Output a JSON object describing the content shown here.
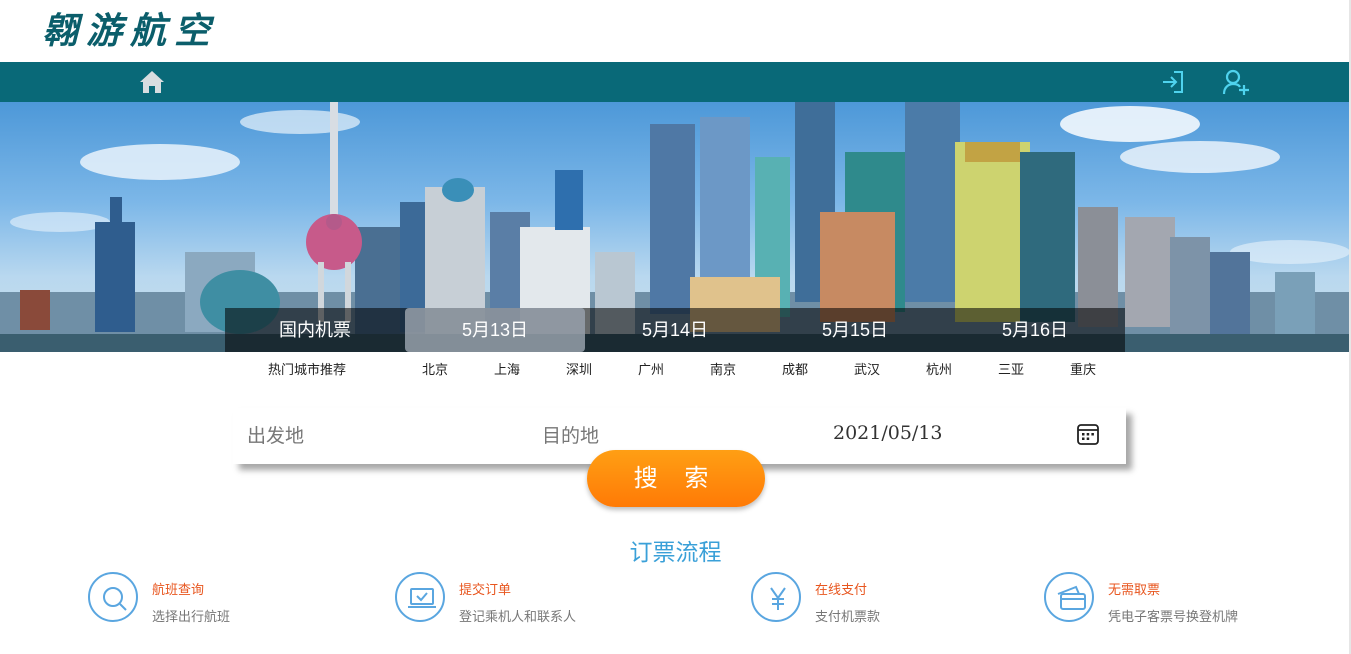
{
  "header": {
    "logo_text": "翱游航空"
  },
  "nav": {
    "home_icon": "home-icon",
    "login_icon": "login-icon",
    "register_icon": "add-user-icon",
    "bar_color": "#096978"
  },
  "banner": {
    "image": "shanghai-skyline-photo"
  },
  "date_tabs": [
    {
      "label": "国内机票"
    },
    {
      "label": "5月13日",
      "active": true
    },
    {
      "label": "5月14日"
    },
    {
      "label": "5月15日"
    },
    {
      "label": "5月16日"
    }
  ],
  "hot_cities": {
    "label": "热门城市推荐",
    "cities": [
      "北京",
      "上海",
      "深圳",
      "广州",
      "南京",
      "成都",
      "武汉",
      "杭州",
      "三亚",
      "重庆"
    ]
  },
  "search": {
    "from_placeholder": "出发地",
    "to_placeholder": "目的地",
    "date_value": "2021/05/13",
    "calendar_icon": "calendar-icon",
    "button_label": "搜 索",
    "button_color": "#ff8a0d"
  },
  "process": {
    "title": "订票流程",
    "steps": [
      {
        "title": "航班查询",
        "desc": "选择出行航班",
        "icon": "search-icon"
      },
      {
        "title": "提交订单",
        "desc": "登记乘机人和联系人",
        "icon": "laptop-check-icon"
      },
      {
        "title": "在线支付",
        "desc": "支付机票款",
        "icon": "yen-icon"
      },
      {
        "title": "无需取票",
        "desc": "凭电子客票号换登机牌",
        "icon": "card-icon"
      }
    ]
  }
}
